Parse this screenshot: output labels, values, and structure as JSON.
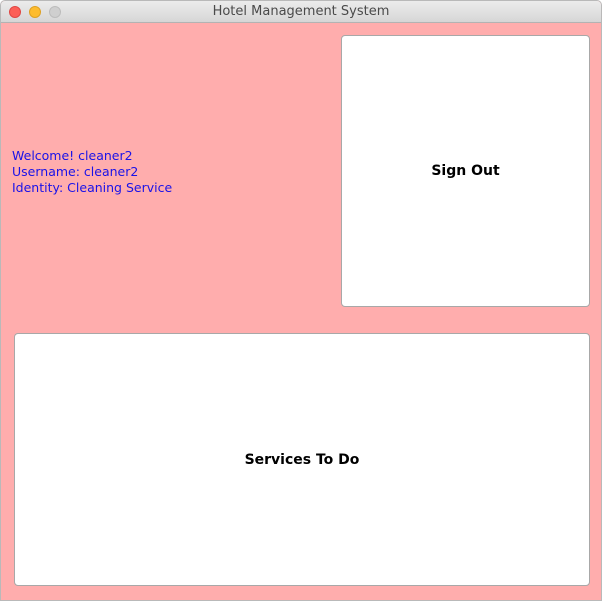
{
  "window": {
    "title": "Hotel Management System"
  },
  "user_info": {
    "welcome": "Welcome! cleaner2",
    "username": "Username: cleaner2",
    "identity": "Identity: Cleaning Service"
  },
  "buttons": {
    "sign_out": "Sign Out",
    "services_to_do": "Services To Do"
  },
  "colors": {
    "background": "#ffadad",
    "info_text": "#1a12e8",
    "button_bg": "#ffffff"
  }
}
